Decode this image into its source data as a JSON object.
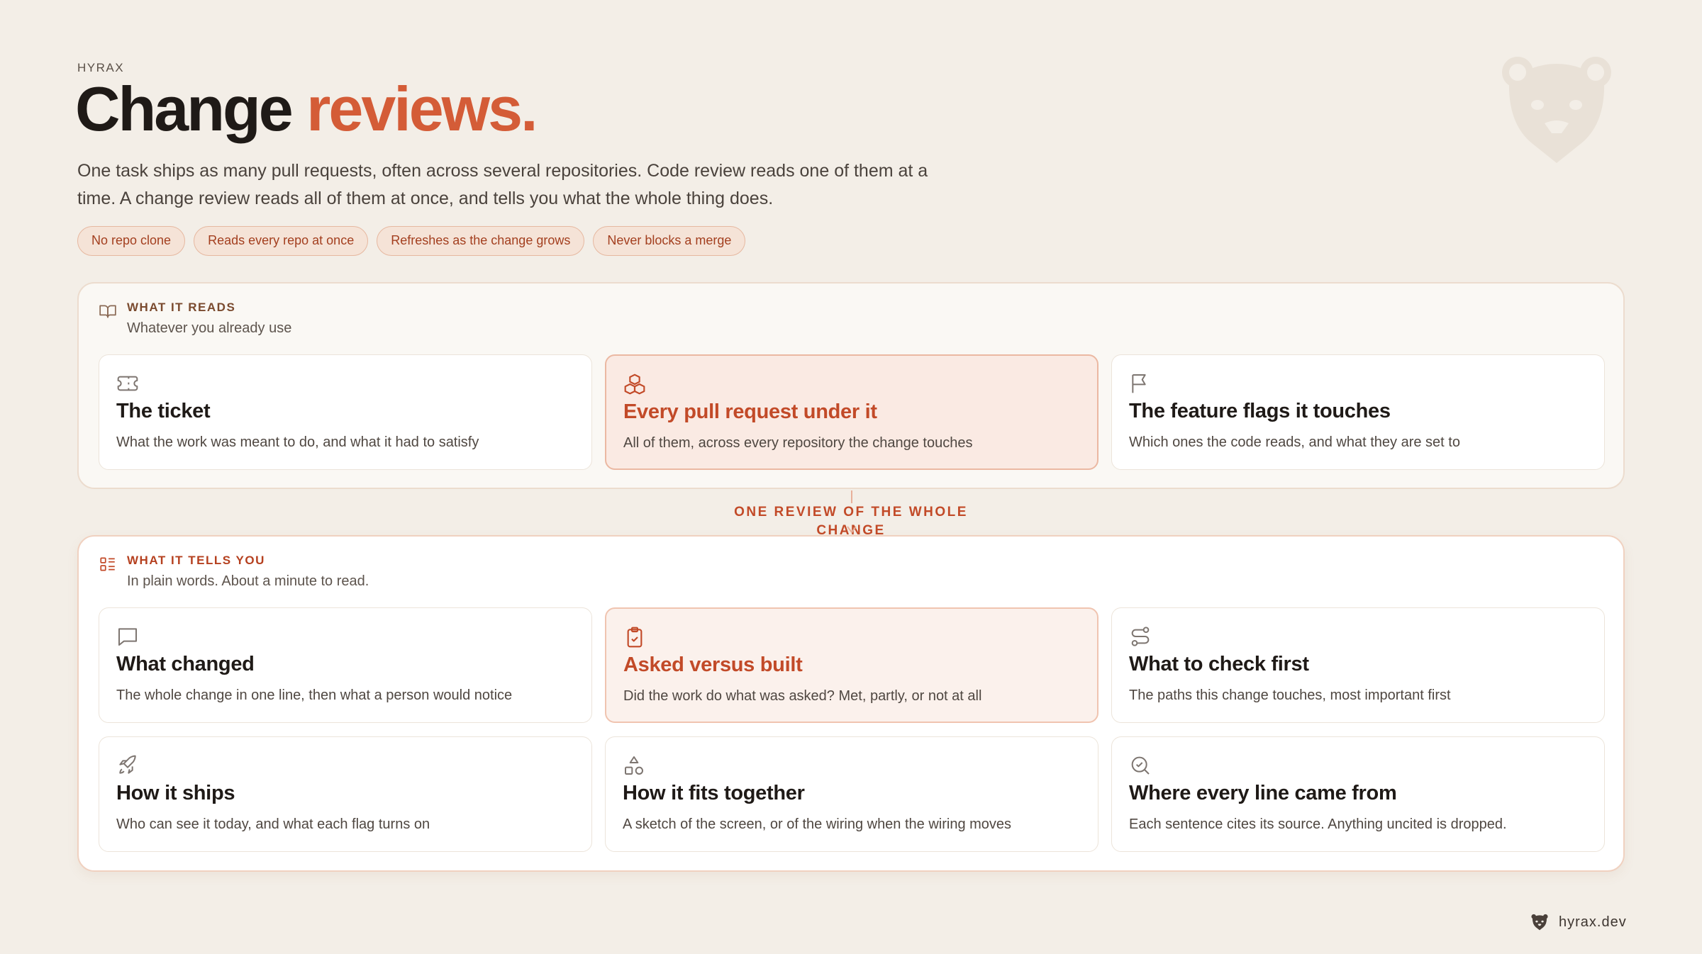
{
  "header": {
    "eyebrow": "HYRAX",
    "title_main": "Change",
    "title_accent": "reviews.",
    "lede": "One task ships as many pull requests, often across several repositories. Code review reads one of them at a time. A change review reads all of them at once, and tells you what the whole thing does."
  },
  "pills": [
    "No repo clone",
    "Reads every repo at once",
    "Refreshes as the change grows",
    "Never blocks a merge"
  ],
  "reads": {
    "label": "WHAT IT READS",
    "subtitle": "Whatever you already use",
    "icon": "book-open-icon",
    "cards": [
      {
        "title": "The ticket",
        "desc": "What the work was meant to do, and what it had to satisfy",
        "icon": "ticket-icon"
      },
      {
        "title": "Every pull request under it",
        "desc": "All of them, across every repository the change touches",
        "icon": "boxes-icon"
      },
      {
        "title": "The feature flags it touches",
        "desc": "Which ones the code reads, and what they are set to",
        "icon": "flag-icon"
      }
    ]
  },
  "connector": {
    "label": "ONE REVIEW OF THE WHOLE CHANGE"
  },
  "tells": {
    "label": "WHAT IT TELLS YOU",
    "subtitle": "In plain words. About a minute to read.",
    "icon": "list-icon",
    "cards": [
      {
        "title": "What changed",
        "desc": "The whole change in one line, then what a person would notice",
        "icon": "message-square-icon"
      },
      {
        "title": "Asked versus built",
        "desc": "Did the work do what was asked? Met, partly, or not at all",
        "icon": "clipboard-check-icon"
      },
      {
        "title": "What to check first",
        "desc": "The paths this change touches, most important first",
        "icon": "route-icon"
      },
      {
        "title": "How it ships",
        "desc": "Who can see it today, and what each flag turns on",
        "icon": "rocket-icon"
      },
      {
        "title": "How it fits together",
        "desc": "A sketch of the screen, or of the wiring when the wiring moves",
        "icon": "shapes-icon"
      },
      {
        "title": "Where every line came from",
        "desc": "Each sentence cites its source. Anything uncited is dropped.",
        "icon": "search-check-icon"
      }
    ]
  },
  "footer": {
    "site": "hyrax.dev"
  },
  "colors": {
    "accent": "#d45c37",
    "background": "#f3eee7",
    "highlight": "#faeae3"
  }
}
